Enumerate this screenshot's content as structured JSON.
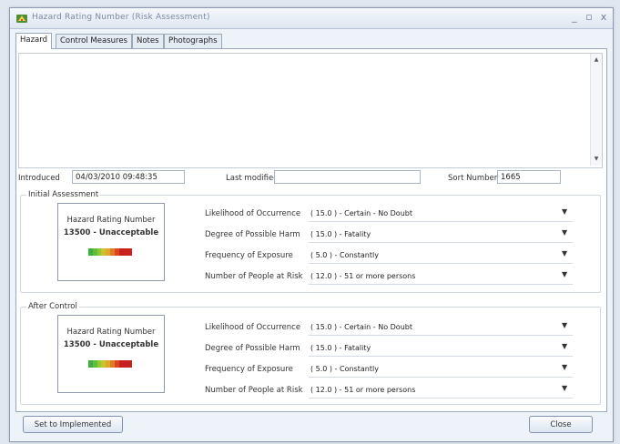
{
  "window": {
    "title": "Hazard Rating Number (Risk Assessment)"
  },
  "tabs": [
    {
      "label": "Hazard"
    },
    {
      "label": "Control Measures"
    },
    {
      "label": "Notes"
    },
    {
      "label": "Photographs"
    }
  ],
  "hazard": {
    "description": "",
    "introduced_label": "Introduced",
    "introduced_value": "04/03/2010 09:48:35",
    "last_modified_label": "Last modified",
    "last_modified_value": "",
    "sort_number_label": "Sort Number",
    "sort_number_value": "1665"
  },
  "initial": {
    "title": "Initial Assessment",
    "rating_title": "Hazard Rating Number",
    "rating_value": "13500 - Unacceptable",
    "meter_colors": [
      "#3cb043",
      "#5fbf3a",
      "#8fc934",
      "#c9c42e",
      "#e0a829",
      "#e07a25",
      "#d9471f",
      "#c8201c",
      "#c8201c",
      "#c8201c"
    ],
    "rows": [
      {
        "label": "Likelihood of Occurrence",
        "value": "( 15.0 ) - Certain - No Doubt"
      },
      {
        "label": "Degree of Possible Harm",
        "value": "( 15.0 ) - Fatality"
      },
      {
        "label": "Frequency of Exposure",
        "value": "( 5.0 ) - Constantly"
      },
      {
        "label": "Number of People at Risk",
        "value": "( 12.0 ) - 51 or more persons"
      }
    ]
  },
  "after": {
    "title": "After Control",
    "rating_title": "Hazard Rating Number",
    "rating_value": "13500 - Unacceptable",
    "rows": [
      {
        "label": "Likelihood of Occurrence",
        "value": "( 15.0 ) - Certain - No Doubt"
      },
      {
        "label": "Degree of Possible Harm",
        "value": "( 15.0 ) - Fatality"
      },
      {
        "label": "Frequency of Exposure",
        "value": "( 5.0 ) - Constantly"
      },
      {
        "label": "Number of People at Risk",
        "value": "( 12.0 ) - 51 or more persons"
      }
    ]
  },
  "buttons": {
    "set_implemented": "Set to Implemented",
    "close": "Close"
  },
  "glyphs": {
    "minimize": "_",
    "maximize": "▫",
    "close": "x",
    "dropdown": "▼",
    "scroll_up": "▲",
    "scroll_down": "▼"
  }
}
